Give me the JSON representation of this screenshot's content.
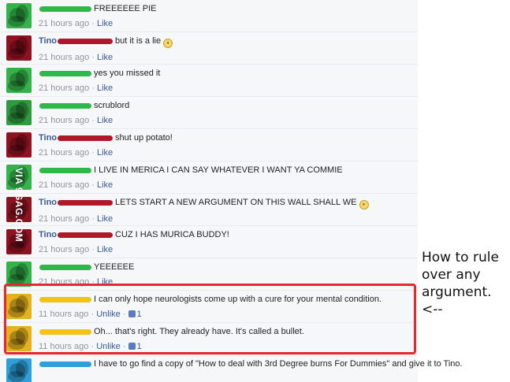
{
  "comments": [
    {
      "author": "",
      "text": "FREEEEEE PIE",
      "time": "21 hours ago",
      "like": "Like",
      "scribble": "#2fb84a",
      "avatar": "#33b34a",
      "emoji": false
    },
    {
      "author": "Tino",
      "text": "but it is a lie",
      "time": "21 hours ago",
      "like": "Like",
      "scribble": "#b0182a",
      "avatar": "#8e1220",
      "emoji": true
    },
    {
      "author": "",
      "text": "yes you missed it",
      "time": "21 hours ago",
      "like": "Like",
      "scribble": "#2fb84a",
      "avatar": "#33b34a",
      "emoji": false
    },
    {
      "author": "",
      "text": "scrublord",
      "time": "21 hours ago",
      "like": "Like",
      "scribble": "#2fb84a",
      "avatar": "#2f9a3e",
      "emoji": false
    },
    {
      "author": "Tino",
      "text": "shut up potato!",
      "time": "21 hours ago",
      "like": "Like",
      "scribble": "#b0182a",
      "avatar": "#8e1220",
      "emoji": false
    },
    {
      "author": "",
      "text": "I LIVE IN MERICA I CAN SAY WHATEVER I WANT YA COMMIE",
      "time": "21 hours ago",
      "like": "Like",
      "scribble": "#2fb84a",
      "avatar": "#33b34a",
      "emoji": false
    },
    {
      "author": "Tino",
      "text": "LETS START A NEW ARGUMENT ON THIS WALL SHALL WE",
      "time": "21 hours ago",
      "like": "Like",
      "scribble": "#b0182a",
      "avatar": "#8e1220",
      "emoji": true
    },
    {
      "author": "Tino",
      "text": "CUZ I HAS MURICA BUDDY!",
      "time": "21 hours ago",
      "like": "Like",
      "scribble": "#b0182a",
      "avatar": "#8e1220",
      "emoji": false
    },
    {
      "author": "",
      "text": "YEEEEEE",
      "time": "21 hours ago",
      "like": "Like",
      "scribble": "#2fb84a",
      "avatar": "#33b34a",
      "emoji": false
    },
    {
      "author": "",
      "text": "I can only hope neurologists come up with a cure for your mental condition.",
      "time": "11 hours ago",
      "like": "Unlike",
      "likes": "1",
      "scribble": "#f2c21a",
      "avatar": "#e3b21e",
      "emoji": false
    },
    {
      "author": "",
      "text": "Oh... that's right. They already have. It's called a bullet.",
      "time": "11 hours ago",
      "like": "Unlike",
      "likes": "1",
      "scribble": "#f2c21a",
      "avatar": "#e3b21e",
      "emoji": false
    },
    {
      "author": "",
      "text": "I have to go find a copy of \"How to deal with 3rd Degree burns For Dummies\" and give it to Tino.",
      "time": "",
      "like": "",
      "scribble": "#2e9fd8",
      "avatar": "#2e9fd8",
      "emoji": false
    }
  ],
  "watermark": "VIA 9GAG.COM",
  "annotation": [
    "How to rule",
    "over any",
    "argument.",
    "<--"
  ],
  "meta_separator": " · "
}
